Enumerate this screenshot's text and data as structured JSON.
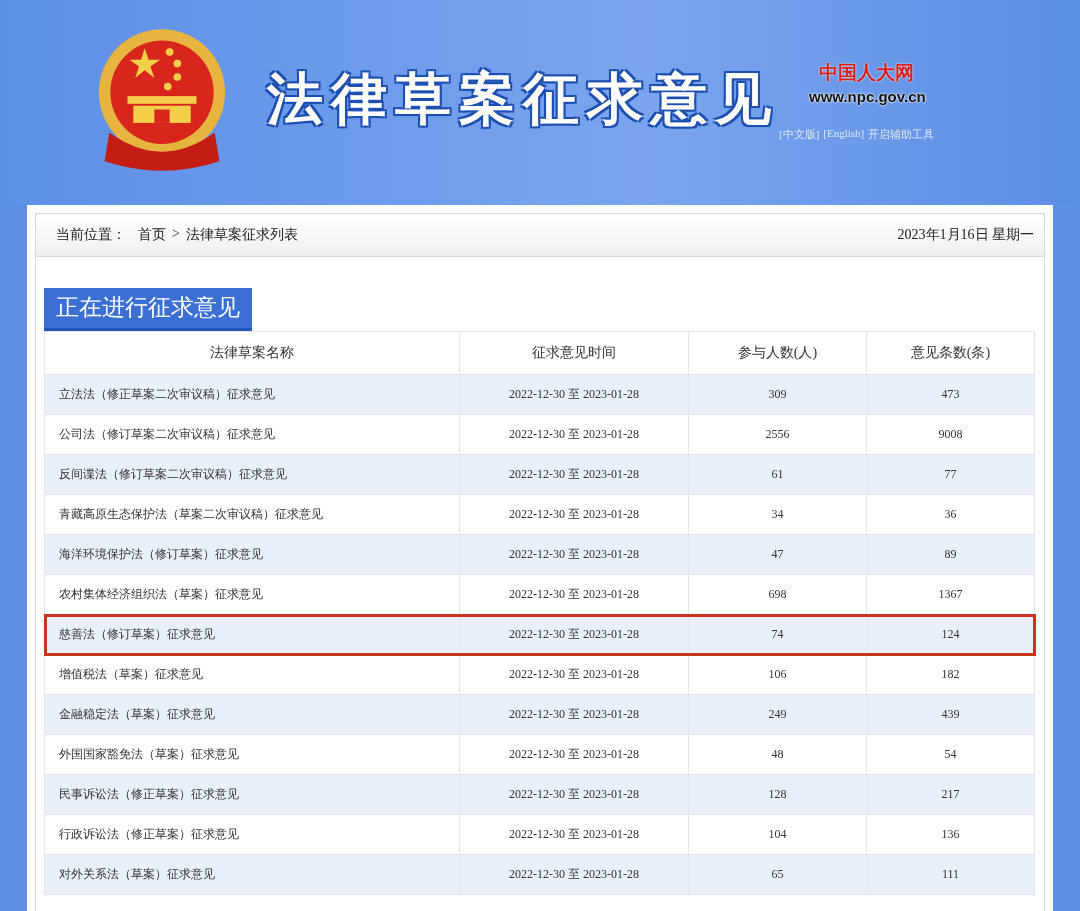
{
  "header": {
    "title": "法律草案征求意见",
    "site_logo": "中国人大网",
    "site_url": "www.npc.gov.cn",
    "links": [
      "[中文版]",
      "[English]",
      "开启辅助工具"
    ]
  },
  "breadcrumb": {
    "label": "当前位置：",
    "items": [
      "首页",
      "法律草案征求列表"
    ],
    "separator": ">",
    "date": "2023年1月16日 星期一"
  },
  "section_title": "正在进行征求意见",
  "table": {
    "columns": [
      "法律草案名称",
      "征求意见时间",
      "参与人数(人)",
      "意见条数(条)"
    ],
    "rows": [
      {
        "name": "立法法（修正草案二次审议稿）征求意见",
        "period": "2022-12-30 至 2023-01-28",
        "participants": "309",
        "opinions": "473",
        "highlighted": false
      },
      {
        "name": "公司法（修订草案二次审议稿）征求意见",
        "period": "2022-12-30 至 2023-01-28",
        "participants": "2556",
        "opinions": "9008",
        "highlighted": false
      },
      {
        "name": "反间谍法（修订草案二次审议稿）征求意见",
        "period": "2022-12-30 至 2023-01-28",
        "participants": "61",
        "opinions": "77",
        "highlighted": false
      },
      {
        "name": "青藏高原生态保护法（草案二次审议稿）征求意见",
        "period": "2022-12-30 至 2023-01-28",
        "participants": "34",
        "opinions": "36",
        "highlighted": false
      },
      {
        "name": "海洋环境保护法（修订草案）征求意见",
        "period": "2022-12-30 至 2023-01-28",
        "participants": "47",
        "opinions": "89",
        "highlighted": false
      },
      {
        "name": "农村集体经济组织法（草案）征求意见",
        "period": "2022-12-30 至 2023-01-28",
        "participants": "698",
        "opinions": "1367",
        "highlighted": false
      },
      {
        "name": "慈善法（修订草案）征求意见",
        "period": "2022-12-30 至 2023-01-28",
        "participants": "74",
        "opinions": "124",
        "highlighted": true
      },
      {
        "name": "增值税法（草案）征求意见",
        "period": "2022-12-30 至 2023-01-28",
        "participants": "106",
        "opinions": "182",
        "highlighted": false
      },
      {
        "name": "金融稳定法（草案）征求意见",
        "period": "2022-12-30 至 2023-01-28",
        "participants": "249",
        "opinions": "439",
        "highlighted": false
      },
      {
        "name": "外国国家豁免法（草案）征求意见",
        "period": "2022-12-30 至 2023-01-28",
        "participants": "48",
        "opinions": "54",
        "highlighted": false
      },
      {
        "name": "民事诉讼法（修正草案）征求意见",
        "period": "2022-12-30 至 2023-01-28",
        "participants": "128",
        "opinions": "217",
        "highlighted": false
      },
      {
        "name": "行政诉讼法（修正草案）征求意见",
        "period": "2022-12-30 至 2023-01-28",
        "participants": "104",
        "opinions": "136",
        "highlighted": false
      },
      {
        "name": "对外关系法（草案）征求意见",
        "period": "2022-12-30 至 2023-01-28",
        "participants": "65",
        "opinions": "111",
        "highlighted": false
      }
    ]
  }
}
